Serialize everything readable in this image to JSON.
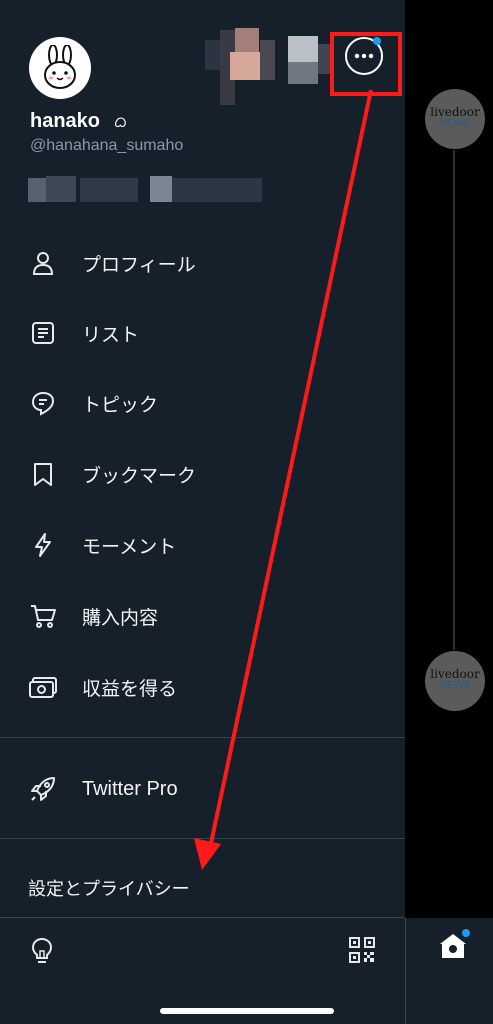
{
  "profile": {
    "name": "hanako",
    "name_emoji": "ᜊ",
    "handle": "@hanahana_sumaho"
  },
  "menu": [
    {
      "label": "プロフィール",
      "icon": "person-icon"
    },
    {
      "label": "リスト",
      "icon": "list-icon"
    },
    {
      "label": "トピック",
      "icon": "topic-icon"
    },
    {
      "label": "ブックマーク",
      "icon": "bookmark-icon"
    },
    {
      "label": "モーメント",
      "icon": "lightning-icon"
    },
    {
      "label": "購入内容",
      "icon": "cart-icon"
    },
    {
      "label": "収益を得る",
      "icon": "money-icon"
    }
  ],
  "twitter_pro": {
    "label": "Twitter Pro",
    "icon": "rocket-icon"
  },
  "settings": {
    "label": "設定とプライバシー"
  },
  "right_panel": {
    "news_line1": "livedoor",
    "news_line2": "NEWS"
  },
  "colors": {
    "background": "#15202b",
    "accent": "#1d9bf0",
    "annotation": "#ff1a1a"
  }
}
